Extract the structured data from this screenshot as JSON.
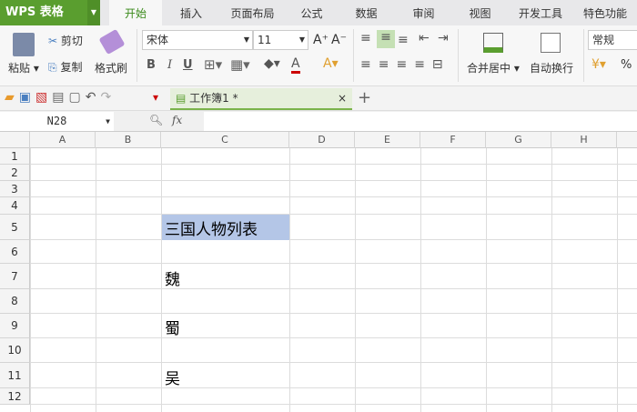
{
  "app": {
    "name": "WPS 表格"
  },
  "tabs": [
    "开始",
    "插入",
    "页面布局",
    "公式",
    "数据",
    "审阅",
    "视图",
    "开发工具",
    "特色功能"
  ],
  "ribbon": {
    "paste": "粘贴",
    "cut": "剪切",
    "copy": "复制",
    "format_painter": "格式刷",
    "font": "宋体",
    "font_size": "11",
    "bold": "B",
    "italic": "I",
    "underline": "U",
    "merge": "合并居中",
    "wrap": "自动换行",
    "number_format": "常规",
    "percent": "%"
  },
  "doc_tab": {
    "title": "工作簿1 *"
  },
  "formula_bar": {
    "name_box": "N28",
    "fx": "fx",
    "value": ""
  },
  "columns": [
    "A",
    "B",
    "C",
    "D",
    "E",
    "F",
    "G",
    "H"
  ],
  "rows": [
    "1",
    "2",
    "3",
    "4",
    "5",
    "6",
    "7",
    "8",
    "9",
    "10",
    "11",
    "12"
  ],
  "cells": {
    "C5": "三国人物列表",
    "C7": "魏",
    "C9": "蜀",
    "C11": "吴"
  },
  "colors": {
    "accent": "#5a9e2f",
    "selection": "#b4c6e7"
  }
}
